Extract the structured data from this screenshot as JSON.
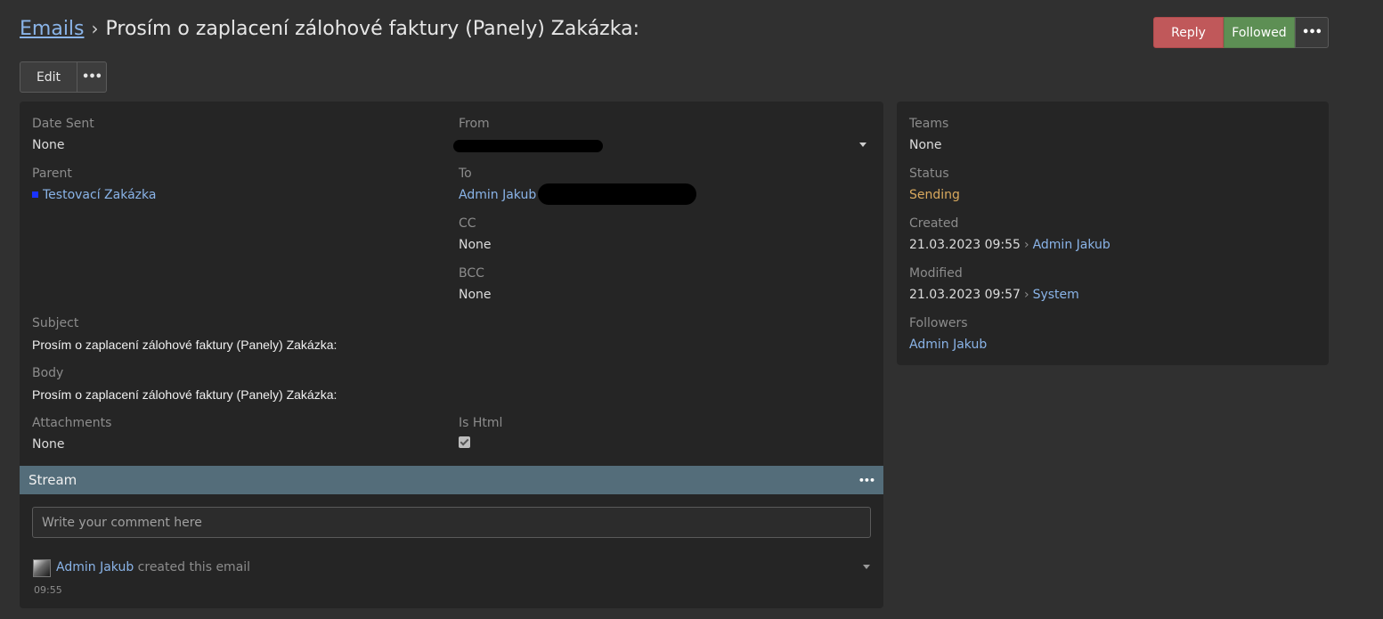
{
  "breadcrumb": {
    "root": "Emails",
    "separator": "›",
    "title": "Prosím o zaplacení zálohové faktury (Panely) Zakázka:"
  },
  "header_actions": {
    "reply": "Reply",
    "followed": "Followed",
    "more": "•••"
  },
  "toolbar": {
    "edit": "Edit",
    "more": "•••"
  },
  "fields": {
    "date_sent": {
      "label": "Date Sent",
      "value": "None"
    },
    "from": {
      "label": "From"
    },
    "parent": {
      "label": "Parent",
      "value": "Testovací Zakázka"
    },
    "to": {
      "label": "To",
      "value": "Admin Jakub"
    },
    "cc": {
      "label": "CC",
      "value": "None"
    },
    "bcc": {
      "label": "BCC",
      "value": "None"
    },
    "subject": {
      "label": "Subject",
      "value": "Prosím o zaplacení zálohové faktury (Panely) Zakázka:"
    },
    "body": {
      "label": "Body",
      "value": "Prosím o zaplacení zálohové faktury (Panely) Zakázka:"
    },
    "attachments": {
      "label": "Attachments",
      "value": "None"
    },
    "is_html": {
      "label": "Is Html",
      "checked": true
    }
  },
  "side": {
    "teams": {
      "label": "Teams",
      "value": "None"
    },
    "status": {
      "label": "Status",
      "value": "Sending",
      "color": "#d9a95e"
    },
    "created": {
      "label": "Created",
      "date": "21.03.2023 09:55",
      "by": "Admin Jakub"
    },
    "modified": {
      "label": "Modified",
      "date": "21.03.2023 09:57",
      "by": "System"
    },
    "followers": {
      "label": "Followers",
      "value": "Admin Jakub"
    }
  },
  "stream": {
    "title": "Stream",
    "more": "•••",
    "comment_placeholder": "Write your comment here",
    "entries": [
      {
        "user": "Admin Jakub",
        "action": "created this email",
        "time": "09:55"
      }
    ]
  },
  "colors": {
    "reply": "#c0585a",
    "followed": "#5d8f54",
    "stream_header": "#546d7a",
    "link": "#8ab4e8",
    "parent_marker": "#1a33ff"
  }
}
